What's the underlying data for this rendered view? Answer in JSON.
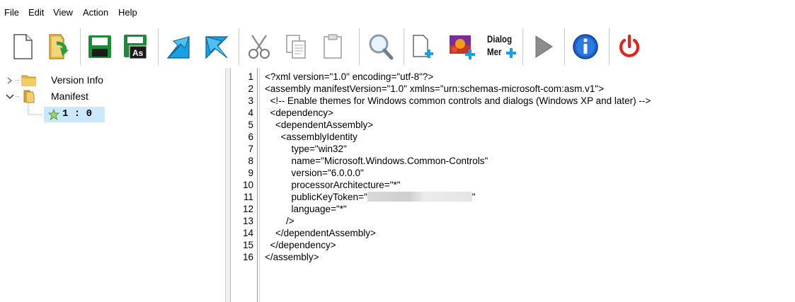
{
  "menu": {
    "items": [
      "File",
      "Edit",
      "View",
      "Action",
      "Help"
    ]
  },
  "toolbar": {
    "buttons": [
      {
        "name": "new-file-button",
        "icon": "new-document-icon"
      },
      {
        "name": "open-button",
        "icon": "open-folder-icon"
      },
      {
        "name": "save-button",
        "icon": "save-icon"
      },
      {
        "name": "save-as-button",
        "icon": "save-as-icon",
        "label": "As"
      },
      {
        "name": "import-button",
        "icon": "import-icon"
      },
      {
        "name": "export-button",
        "icon": "export-icon"
      },
      {
        "name": "cut-button",
        "icon": "scissors-icon"
      },
      {
        "name": "copy-button",
        "icon": "copy-icon"
      },
      {
        "name": "paste-button",
        "icon": "paste-icon"
      },
      {
        "name": "find-button",
        "icon": "magnifier-icon"
      },
      {
        "name": "add-resource-button",
        "icon": "add-resource-icon"
      },
      {
        "name": "add-image-button",
        "icon": "add-image-icon"
      },
      {
        "name": "dialog-merge-button",
        "icon": "dialog-merge-icon",
        "label_line1": "Dialog",
        "label_line2": "Mer"
      },
      {
        "name": "run-script-button",
        "icon": "play-icon"
      },
      {
        "name": "about-button",
        "icon": "info-icon"
      },
      {
        "name": "exit-button",
        "icon": "power-icon"
      }
    ]
  },
  "tree": {
    "nodes": [
      {
        "label": "Version Info",
        "expanded": false
      },
      {
        "label": "Manifest",
        "expanded": true,
        "children": [
          {
            "label": "1 : 0",
            "selected": true
          }
        ]
      }
    ]
  },
  "editor": {
    "lines": [
      {
        "n": "1",
        "text": "<?xml version=\"1.0\" encoding=\"utf-8\"?>"
      },
      {
        "n": "2",
        "text": "<assembly manifestVersion=\"1.0\" xmlns=\"urn:schemas-microsoft-com:asm.v1\">"
      },
      {
        "n": "3",
        "text": "  <!-- Enable themes for Windows common controls and dialogs (Windows XP and later) -->"
      },
      {
        "n": "4",
        "text": "  <dependency>"
      },
      {
        "n": "5",
        "text": "    <dependentAssembly>"
      },
      {
        "n": "6",
        "text": "      <assemblyIdentity"
      },
      {
        "n": "7",
        "text": "          type=\"win32\""
      },
      {
        "n": "8",
        "text": "          name=\"Microsoft.Windows.Common-Controls\""
      },
      {
        "n": "9",
        "text": "          version=\"6.0.0.0\""
      },
      {
        "n": "10",
        "text": "          processorArchitecture=\"*\""
      },
      {
        "n": "11",
        "text_before": "          publicKeyToken=\"",
        "text_after": "\""
      },
      {
        "n": "12",
        "text": "          language=\"*\""
      },
      {
        "n": "13",
        "text": "        />"
      },
      {
        "n": "14",
        "text": "    </dependentAssembly>"
      },
      {
        "n": "15",
        "text": "  </dependency>"
      },
      {
        "n": "16",
        "text": "</assembly>"
      }
    ]
  },
  "colors": {
    "accent_green": "#1f8a3a",
    "accent_blue": "#1a9fe0",
    "selection": "#cce8ff",
    "power_red": "#e2231a",
    "info_blue": "#1d63c9"
  }
}
